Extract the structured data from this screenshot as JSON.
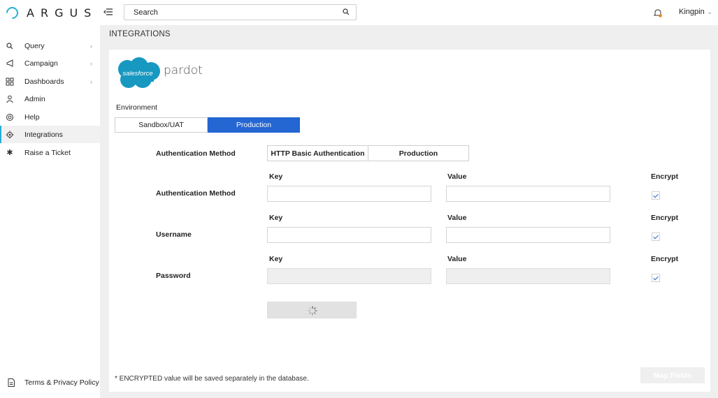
{
  "app": {
    "logo_text": "ARGUS"
  },
  "header": {
    "search_label": "Search",
    "user_name": "Kingpin"
  },
  "sidebar": {
    "items": [
      {
        "label": "Query",
        "icon": "search-icon",
        "has_chevron": true
      },
      {
        "label": "Campaign",
        "icon": "megaphone-icon",
        "has_chevron": true
      },
      {
        "label": "Dashboards",
        "icon": "grid-icon",
        "has_chevron": true
      },
      {
        "label": "Admin",
        "icon": "user-icon",
        "has_chevron": false
      },
      {
        "label": "Help",
        "icon": "lifebuoy-icon",
        "has_chevron": false
      },
      {
        "label": "Integrations",
        "icon": "gear-icon",
        "has_chevron": false,
        "active": true
      },
      {
        "label": "Raise a Ticket",
        "icon": "asterisk-icon",
        "has_chevron": false
      }
    ],
    "footer_label": "Terms & Privacy Policy"
  },
  "page": {
    "title": "INTEGRATIONS"
  },
  "integration": {
    "brand_cloud_text": "salesforce",
    "brand_name": "pardot",
    "environment_label": "Environment",
    "environments": [
      "Sandbox/UAT",
      "Production"
    ],
    "selected_environment": "Production",
    "auth_method_label": "Authentication Method",
    "auth_options": [
      "HTTP Basic Authentication",
      "Production"
    ],
    "col_key": "Key",
    "col_value": "Value",
    "col_encrypt": "Encrypt",
    "rows": [
      {
        "label": "Authentication Method",
        "key": "",
        "value": "",
        "encrypt": true,
        "disabled": false
      },
      {
        "label": "Username",
        "key": "",
        "value": "",
        "encrypt": true,
        "disabled": false
      },
      {
        "label": "Password",
        "key": "",
        "value": "",
        "encrypt": true,
        "disabled": true
      }
    ],
    "footnote": "* ENCRYPTED value will be saved separately in the database.",
    "map_fields_label": "Map Fields"
  },
  "colors": {
    "accent": "#2466d2",
    "brand": "#25b0d6",
    "salesforce_blue": "#1798c1",
    "bell_dot": "#f0861a"
  }
}
